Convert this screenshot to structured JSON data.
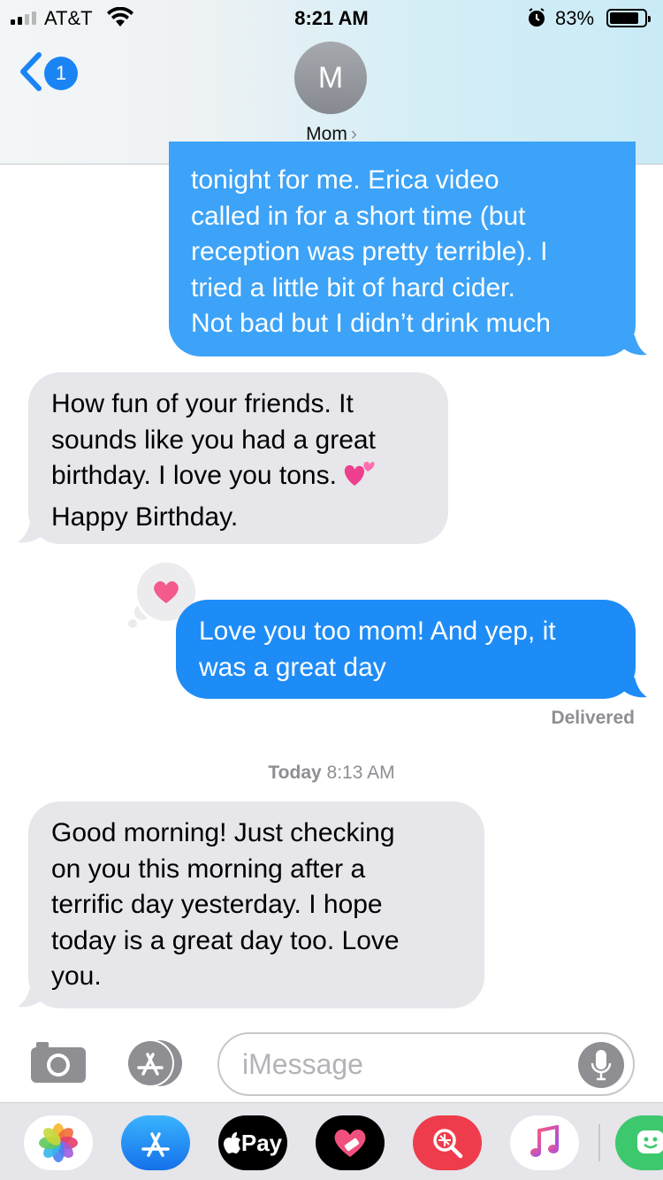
{
  "status_bar": {
    "carrier": "AT&T",
    "time": "8:21 AM",
    "battery_pct": "83%",
    "battery_level": 0.83,
    "signal_bars": 2,
    "icons": [
      "signal-icon",
      "wifi-icon",
      "alarm-icon",
      "battery-icon"
    ]
  },
  "header": {
    "back_badge": "1",
    "avatar_initial": "M",
    "contact_name": "Mom",
    "chevron": "›"
  },
  "messages": [
    {
      "direction": "outgoing",
      "lines": [
        "tonight for me. Erica video",
        "called in for a short time (but",
        "reception was pretty terrible). I",
        "tried a little bit of hard cider.",
        "Not bad but I didn’t drink much"
      ]
    },
    {
      "direction": "incoming",
      "lines": [
        "How fun of your friends. It",
        "sounds like you had a great",
        "birthday. I love you tons.",
        "Happy Birthday."
      ],
      "emoji": "two-hearts-emoji"
    },
    {
      "direction": "outgoing",
      "lines": [
        "Love you too mom! And yep, it",
        "was a great day"
      ],
      "tapback": "heart-icon",
      "status": "Delivered"
    },
    {
      "direction": "incoming",
      "lines": [
        "Good morning!  Just checking",
        "on you this morning after a",
        "terrific day yesterday. I hope",
        "today is a great day too. Love",
        "you."
      ]
    }
  ],
  "timestamp": {
    "day": "Today",
    "time": " 8:13 AM"
  },
  "compose": {
    "placeholder": "iMessage"
  },
  "app_drawer": {
    "apps": [
      "photos-app-icon",
      "app-store-icon",
      "apple-pay-icon",
      "heart-app-icon",
      "image-search-icon",
      "music-icon",
      "bitmoji-icon"
    ],
    "apple_pay_label": "Pay"
  },
  "colors": {
    "outgoing_bubble": "#3ca3f8",
    "incoming_bubble": "#e6e6eb",
    "accent": "#1b84f5"
  }
}
